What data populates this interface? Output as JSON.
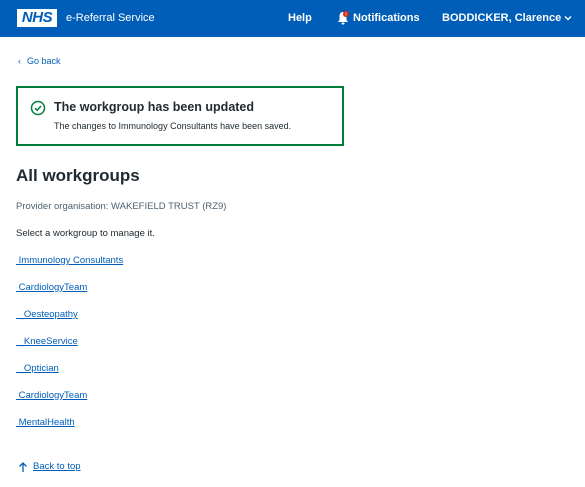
{
  "header": {
    "logo": "NHS",
    "service_name": "e-Referral Service",
    "help": "Help",
    "notifications": "Notifications",
    "user": "BODDICKER, Clarence",
    "notification_badge_color": "#d5281b"
  },
  "back_link": "Go back",
  "banner": {
    "title": "The workgroup has been updated",
    "body": "The changes to Immunology Consultants have been saved.",
    "border_color": "#007f3b"
  },
  "page": {
    "title": "All workgroups",
    "provider": "Provider organisation: WAKEFIELD TRUST (RZ9)",
    "instruction": "Select a workgroup to manage it."
  },
  "workgroups": [
    " Immunology Consultants",
    " CardiologyTeam",
    " _Oesteopathy",
    " _KneeService",
    " _Optician",
    " CardiologyTeam",
    " MentalHealth"
  ],
  "back_to_top": "Back to top",
  "colors": {
    "header_bg": "#005eb8",
    "link": "#005eb8",
    "text": "#212b32"
  }
}
